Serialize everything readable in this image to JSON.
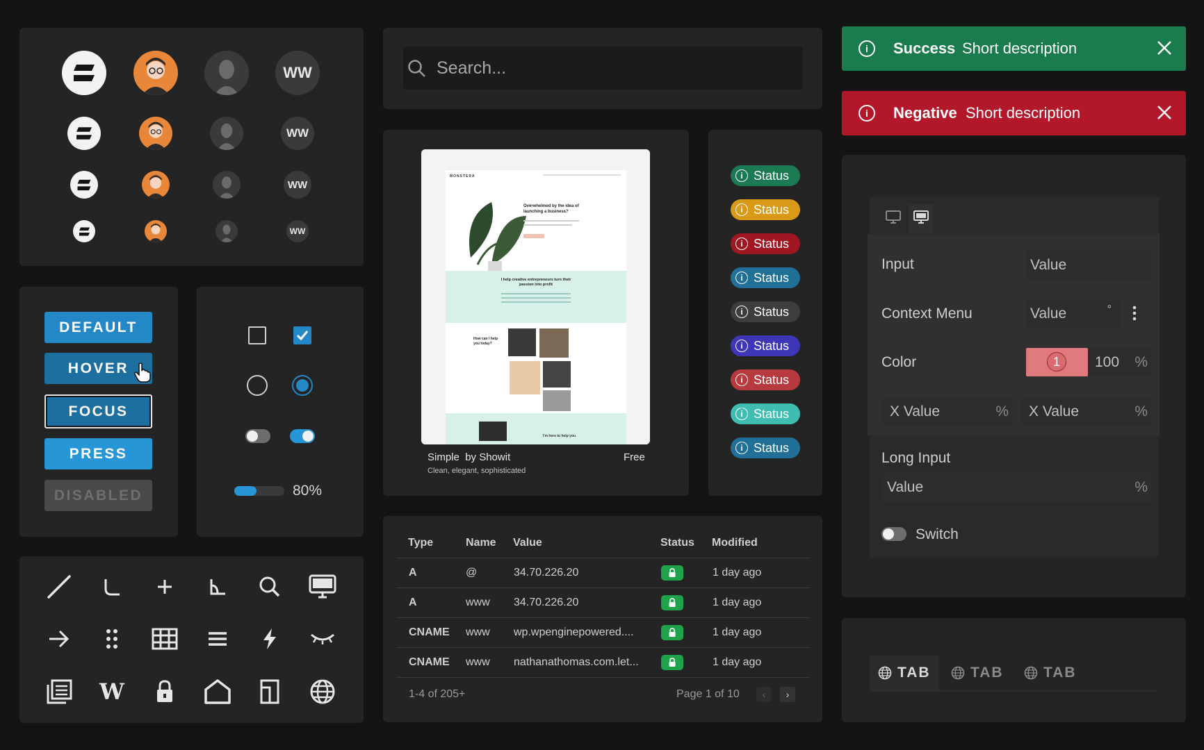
{
  "avatars": {
    "initials": "WW"
  },
  "buttons": {
    "default": "DEFAULT",
    "hover": "HOVER",
    "focus": "FOCUS",
    "press": "PRESS",
    "disabled": "DISABLED"
  },
  "controls": {
    "progress": {
      "value": 0.8,
      "label": "80%"
    }
  },
  "search": {
    "placeholder": "Search..."
  },
  "template_card": {
    "title": "Simple",
    "author": "by Showit",
    "price": "Free",
    "description": "Clean, elegant, sophisticated",
    "preview": {
      "brand": "MONSTERA",
      "headline": "Overwhelmed by the idea of launching a business?",
      "section2": "I help creative entrepreneurs turn their passion into profit",
      "section3": "How can I help you today?",
      "footer": "I'm here to help you"
    }
  },
  "statuses": [
    {
      "label": "Status",
      "color": "#1b7a52"
    },
    {
      "label": "Status",
      "color": "#d99a17"
    },
    {
      "label": "Status",
      "color": "#a01722"
    },
    {
      "label": "Status",
      "color": "#1f6f96"
    },
    {
      "label": "Status",
      "color": "#3d3d3d"
    },
    {
      "label": "Status",
      "color": "#3d37b8"
    },
    {
      "label": "Status",
      "color": "#b73a3e"
    },
    {
      "label": "Status",
      "color": "#3fbdb0"
    },
    {
      "label": "Status",
      "color": "#1f6f96"
    }
  ],
  "alerts": {
    "success": {
      "title": "Success",
      "description": "Short description",
      "color": "#1a7c4c"
    },
    "negative": {
      "title": "Negative",
      "description": "Short description",
      "color": "#b3182a"
    }
  },
  "inspector": {
    "input": {
      "label": "Input",
      "value": "Value"
    },
    "context_menu": {
      "label": "Context Menu",
      "value": "Value",
      "unit": "°"
    },
    "color": {
      "label": "Color",
      "swatch_value": "1",
      "opacity": "100",
      "unit": "%",
      "swatch_color": "#e07a7f"
    },
    "x1": {
      "prefix": "X",
      "value": "Value",
      "unit": "%"
    },
    "x2": {
      "prefix": "X",
      "value": "Value",
      "unit": "%"
    },
    "long_input": {
      "label": "Long Input",
      "value": "Value",
      "unit": "%"
    },
    "switch": {
      "label": "Switch"
    }
  },
  "table": {
    "headers": [
      "Type",
      "Name",
      "Value",
      "Status",
      "Modified"
    ],
    "rows": [
      {
        "type": "A",
        "name": "@",
        "value": "34.70.226.20",
        "modified": "1 day ago"
      },
      {
        "type": "A",
        "name": "www",
        "value": "34.70.226.20",
        "modified": "1 day ago"
      },
      {
        "type": "CNAME",
        "name": "www",
        "value": "wp.wpenginepowered....",
        "modified": "1 day ago"
      },
      {
        "type": "CNAME",
        "name": "www",
        "value": "nathanathomas.com.let...",
        "modified": "1 day ago"
      }
    ],
    "footer": {
      "range": "1-4 of 205+",
      "page": "Page 1 of 10",
      "prev": "‹",
      "next": "›"
    }
  },
  "tabs": [
    {
      "label": "TAB"
    },
    {
      "label": "TAB"
    },
    {
      "label": "TAB"
    }
  ],
  "icons": [
    "line-icon",
    "corner-icon",
    "plus-icon",
    "angle-icon",
    "search-icon",
    "monitor-icon",
    "arrow-right-icon",
    "drag-dots-icon",
    "grid-icon",
    "menu-icon",
    "lightning-icon",
    "eye-closed-icon",
    "layers-icon",
    "wordpress-icon",
    "lock-icon",
    "home-icon",
    "layout-icon",
    "globe-icon"
  ]
}
